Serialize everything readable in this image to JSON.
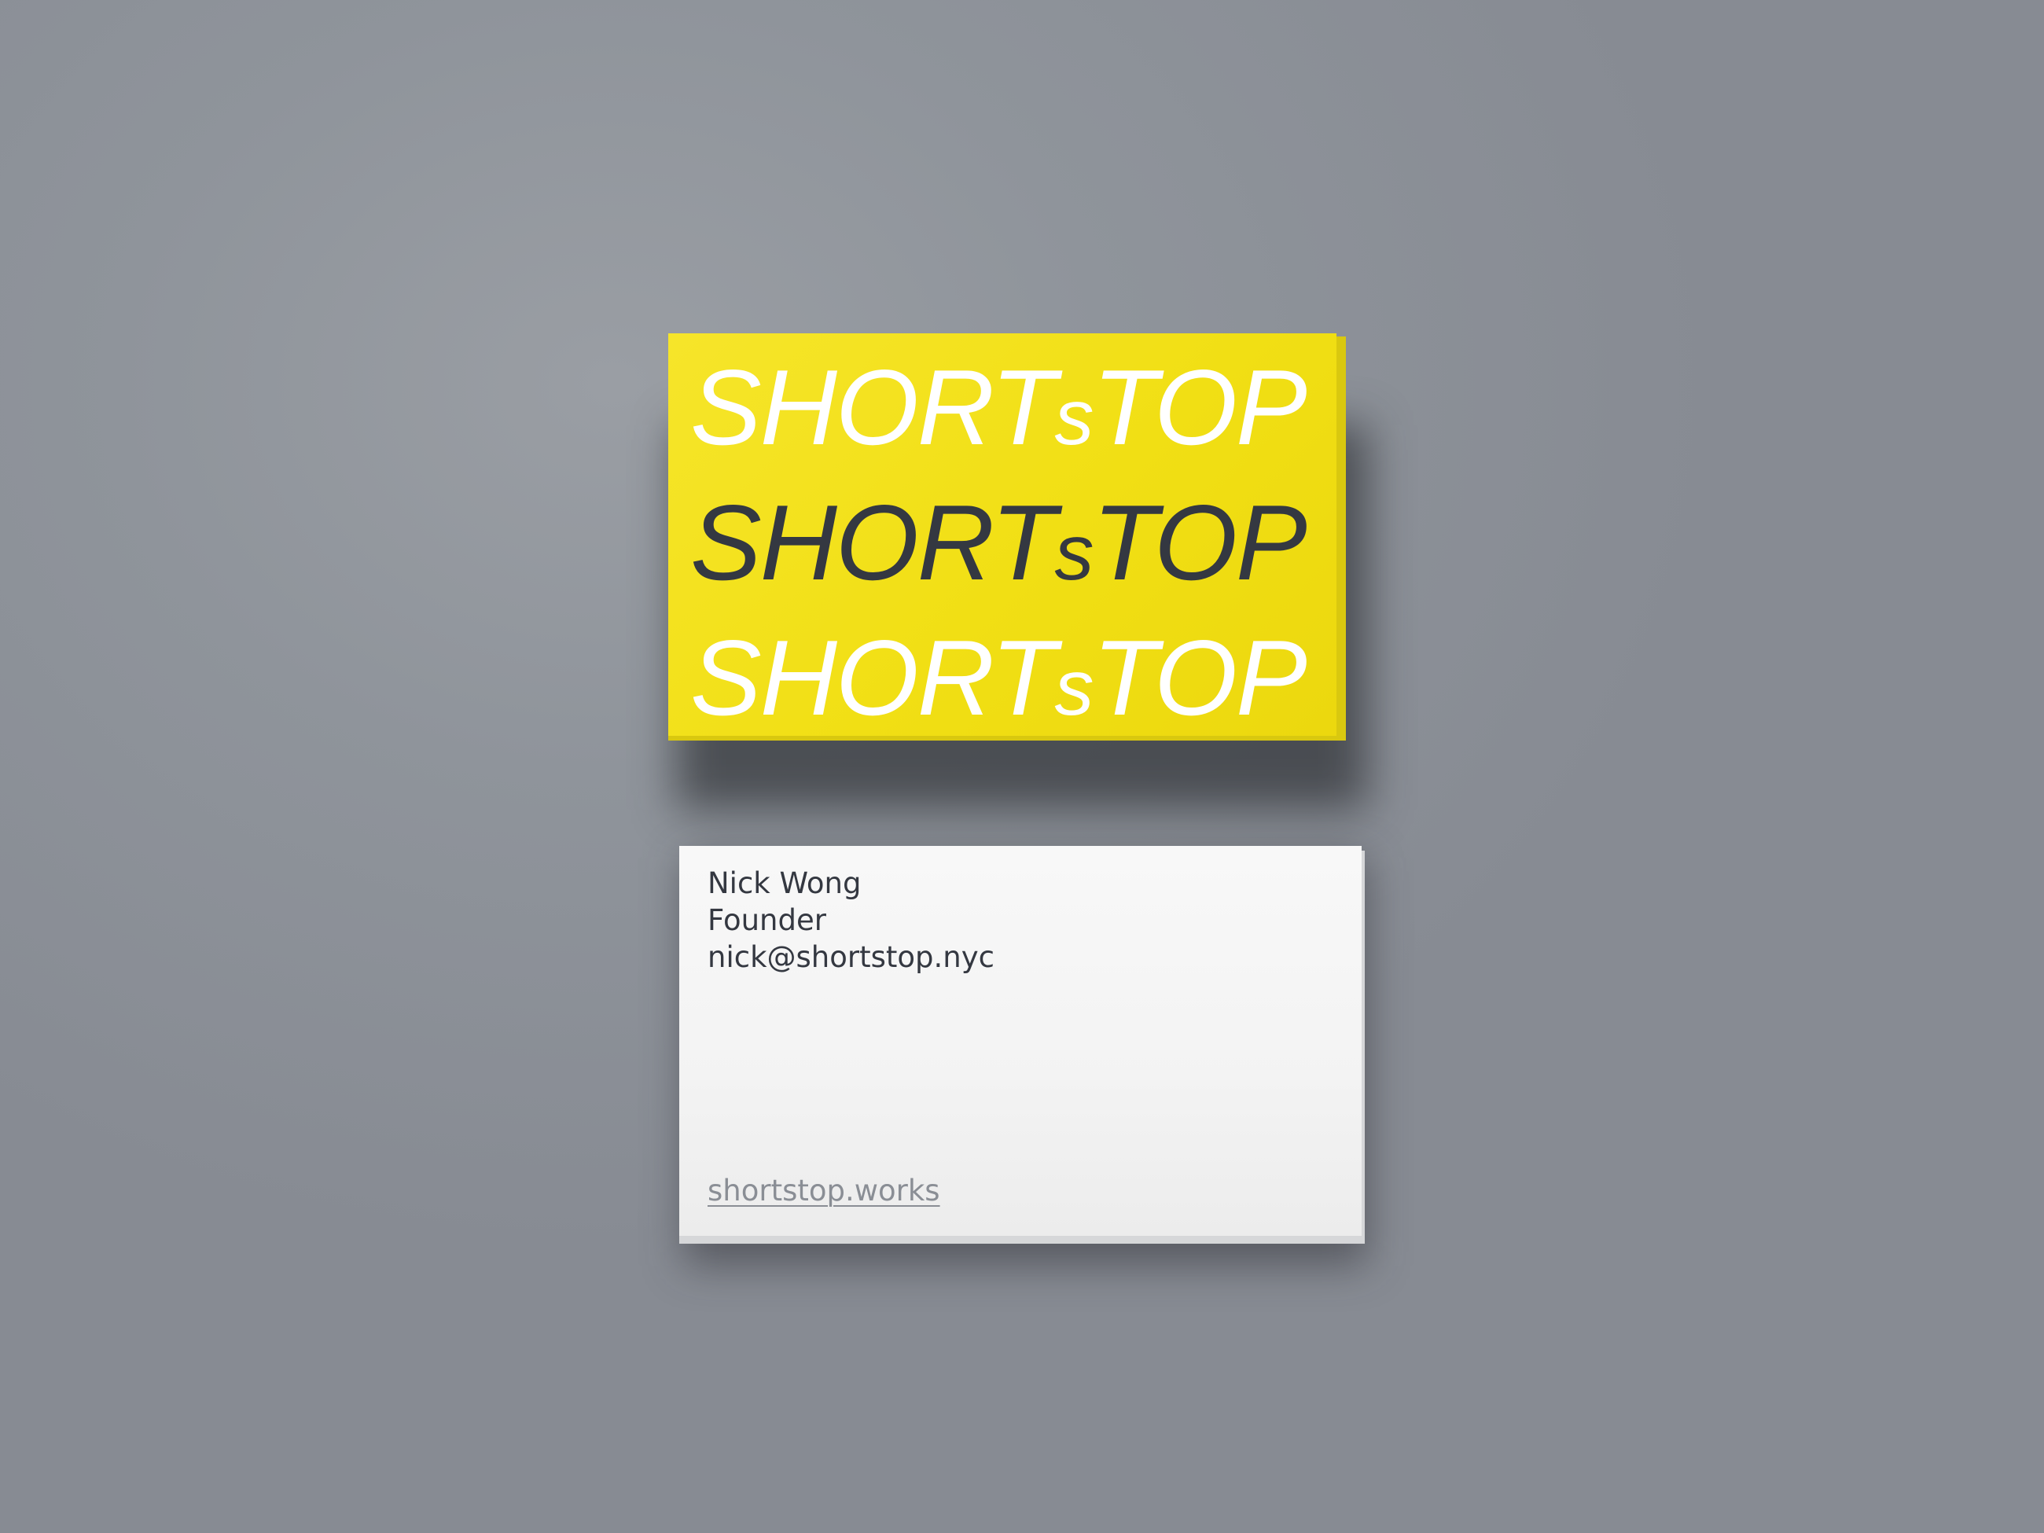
{
  "yellow_card": {
    "wordmark_rows": [
      {
        "before": "SHORT",
        "small": "s",
        "after": "TOP"
      },
      {
        "before": "SHORT",
        "small": "s",
        "after": "TOP"
      },
      {
        "before": "SHORT",
        "small": "s",
        "after": "TOP"
      }
    ]
  },
  "white_card": {
    "name": "Nick Wong",
    "title": "Founder",
    "email": "nick@shortstop.nyc",
    "website": "shortstop.works"
  },
  "colors": {
    "background": "#8f949b",
    "card_yellow": "#f1df14",
    "card_white": "#f5f5f5",
    "text_dark": "#343841",
    "text_light": "#ffffff",
    "link_grey": "#8a8e95"
  }
}
